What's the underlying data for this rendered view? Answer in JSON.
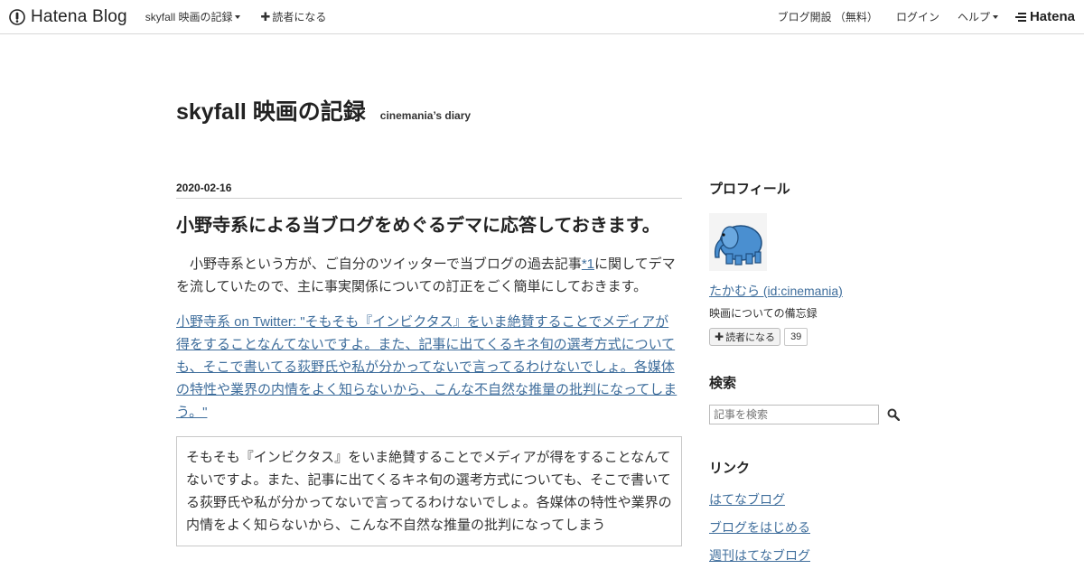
{
  "header": {
    "logo_text": "Hatena Blog",
    "blog_menu_label": "skyfall 映画の記録",
    "subscribe_label": "読者になる",
    "open_blog_label": "ブログ開設 （無料）",
    "login_label": "ログイン",
    "help_label": "ヘルプ",
    "brand_label": "Hatena"
  },
  "blog": {
    "title": "skyfall 映画の記録",
    "description": "cinemania’s diary"
  },
  "entry": {
    "date": "2020-02-16",
    "title": "小野寺系による当ブログをめぐるデマに応答しておきます。",
    "intro_before": "小野寺系という方が、ご自分のツイッターで当ブログの過去記事",
    "footnote": "*1",
    "intro_after": "に関してデマを流していたので、主に事実関係についての訂正をごく簡単にしておきます。",
    "tweet_link": "小野寺系 on Twitter: \"そもそも『インビクタス』をいま絶賛することでメディアが得をすることなんてないですよ。また、記事に出てくるキネ旬の選考方式についても、そこで書いてる荻野氏や私が分かってないで言ってるわけないでしょ。各媒体の特性や業界の内情をよく知らないから、こんな不自然な推量の批判になってしまう。\"",
    "quote": "そもそも『インビクタス』をいま絶賛することでメディアが得をすることなんてないですよ。また、記事に出てくるキネ旬の選考方式についても、そこで書いてる荻野氏や私が分かってないで言ってるわけないでしょ。各媒体の特性や業界の内情をよく知らないから、こんな不自然な推量の批判になってしまう"
  },
  "sidebar": {
    "profile_title": "プロフィール",
    "profile_name": "たかむら (id:cinemania)",
    "profile_desc": "映画についての備忘録",
    "subscribe_label": "読者になる",
    "subscriber_count": "39",
    "search_title": "検索",
    "search_placeholder": "記事を検索",
    "links_title": "リンク",
    "links": [
      {
        "label": "はてなブログ"
      },
      {
        "label": "ブログをはじめる"
      },
      {
        "label": "週刊はてなブログ"
      }
    ]
  },
  "colors": {
    "link": "#3f6e9c",
    "elephant": "#4a8fd0"
  }
}
